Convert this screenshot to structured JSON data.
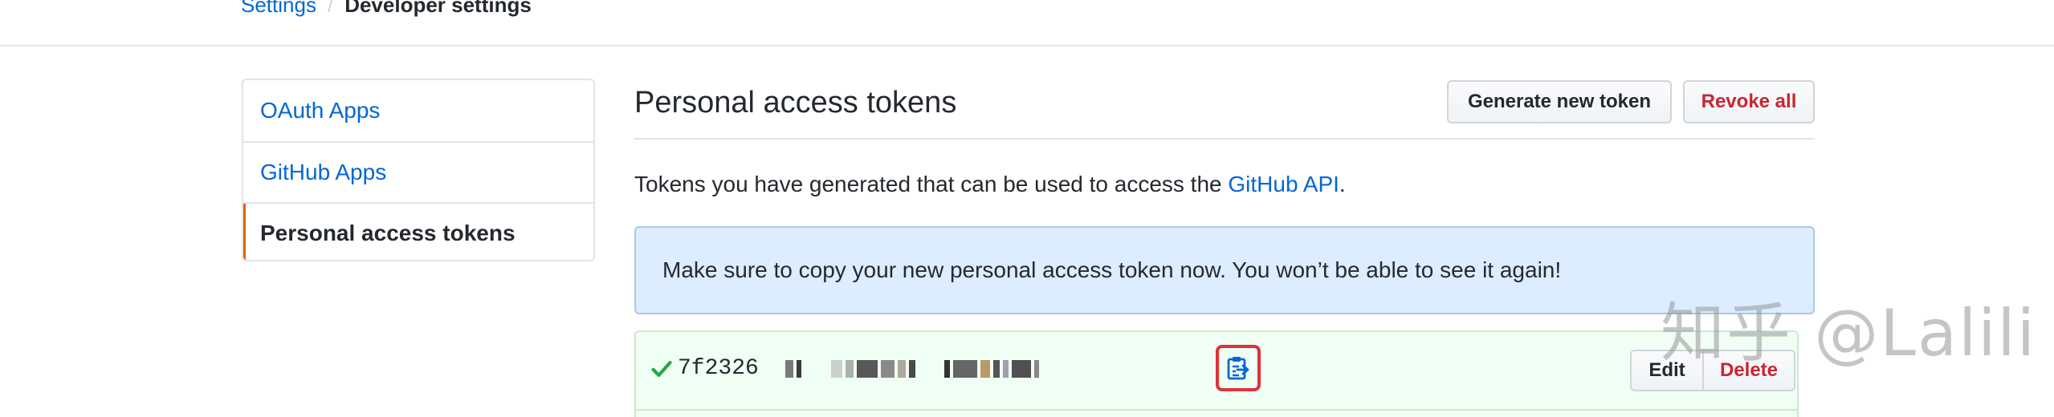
{
  "breadcrumb": {
    "parent": "Settings",
    "separator": "/",
    "current": "Developer settings"
  },
  "sidebar": {
    "items": [
      {
        "label": "OAuth Apps",
        "selected": false
      },
      {
        "label": "GitHub Apps",
        "selected": false
      },
      {
        "label": "Personal access tokens",
        "selected": true
      }
    ]
  },
  "main": {
    "title": "Personal access tokens",
    "generate_label": "Generate new token",
    "revoke_label": "Revoke all",
    "intro_prefix": "Tokens you have generated that can be used to access the ",
    "intro_link": "GitHub API",
    "intro_suffix": ".",
    "flash_message": "Make sure to copy your new personal access token now. You won’t be able to see it again!",
    "token": {
      "visible_prefix": "7f2326",
      "masked": true,
      "edit_label": "Edit",
      "delete_label": "Delete",
      "copy_icon": "clippy-icon",
      "status_icon": "check-icon"
    }
  },
  "watermark": "知乎 @Lalili",
  "colors": {
    "link": "#0366d6",
    "danger": "#cb2431",
    "selected_marker": "#e36209",
    "flash_bg": "#dbedff",
    "token_bg": "#f0fff4",
    "check": "#28a745",
    "highlight_border": "#e0303a"
  }
}
